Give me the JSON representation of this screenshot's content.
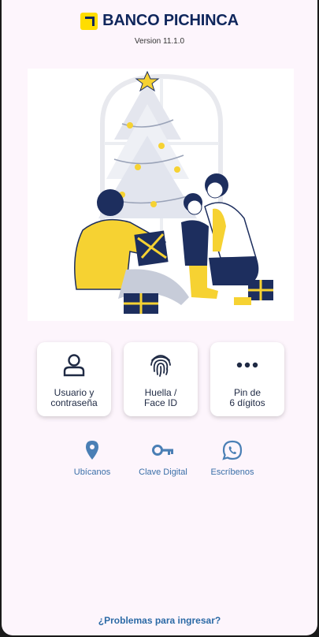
{
  "brand": {
    "name": "BANCO PICHINCA",
    "logo_icon": "pichincha-logo",
    "color": "#0f265c",
    "accent": "#ffdd00"
  },
  "version": "Version 11.1.0",
  "hero": {
    "image": "christmas-family-illustration"
  },
  "login_options": [
    {
      "label": "Usuario y\ncontraseña",
      "icon": "user-icon"
    },
    {
      "label": "Huella /\nFace ID",
      "icon": "fingerprint-icon"
    },
    {
      "label": "Pin de\n6 dígitos",
      "icon": "dots-icon"
    }
  ],
  "quick_links": [
    {
      "label": "Ubícanos",
      "icon": "location-pin-icon"
    },
    {
      "label": "Clave Digital",
      "icon": "key-icon"
    },
    {
      "label": "Escríbenos",
      "icon": "whatsapp-icon"
    }
  ],
  "problems_link": "¿Problemas para ingresar?",
  "colors": {
    "background": "#fdf5fc",
    "link": "#3a6fa8",
    "icon_dark": "#1f2a44"
  }
}
